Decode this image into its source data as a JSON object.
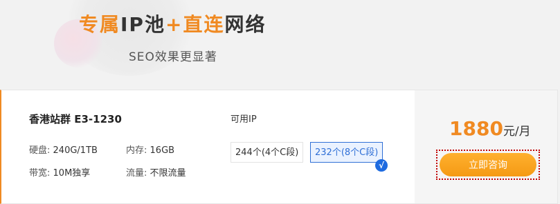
{
  "banner": {
    "title_part1": "专属",
    "title_part2": "IP池",
    "title_plus": "+",
    "title_part3": "直连",
    "title_part4": "网络",
    "subtitle": "SEO效果更显著"
  },
  "product": {
    "name": "香港站群 E3-1230",
    "specs": {
      "disk_label": "硬盘:",
      "disk_value": "240G/1TB",
      "memory_label": "内存:",
      "memory_value": "16GB",
      "bandwidth_label": "带宽:",
      "bandwidth_value": "10M独享",
      "traffic_label": "流量:",
      "traffic_value": "不限流量"
    },
    "ip": {
      "label": "可用IP",
      "options": [
        "244个(4个C段)",
        "232个(8个C段)"
      ],
      "selected_check": "√"
    },
    "price": {
      "amount": "1880",
      "unit": "元/月"
    },
    "consult_button": "立即咨询"
  },
  "colors": {
    "accent_orange": "#f08a22",
    "selected_blue": "#2f6fd6",
    "button_orange": "#f59a14"
  }
}
